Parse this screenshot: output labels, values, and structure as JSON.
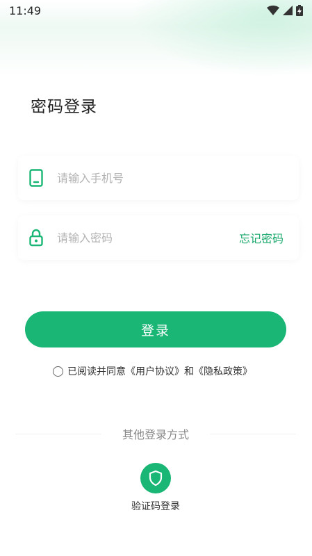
{
  "status_bar": {
    "time": "11:49"
  },
  "page": {
    "title": "密码登录"
  },
  "phone_field": {
    "placeholder": "请输入手机号",
    "icon": "phone-icon"
  },
  "password_field": {
    "placeholder": "请输入密码",
    "icon": "lock-icon",
    "forgot_label": "忘记密码"
  },
  "login_button": {
    "label": "登录"
  },
  "agreement": {
    "prefix": "已阅读并同意",
    "user_agreement": "《用户协议》",
    "and": "和",
    "privacy_policy": "《隐私政策》"
  },
  "other_login": {
    "divider_text": "其他登录方式",
    "options": [
      {
        "label": "验证码登录",
        "icon": "shield-icon"
      }
    ]
  },
  "colors": {
    "accent": "#19b676",
    "link": "#18a86b",
    "placeholder": "#b3b3b3"
  }
}
